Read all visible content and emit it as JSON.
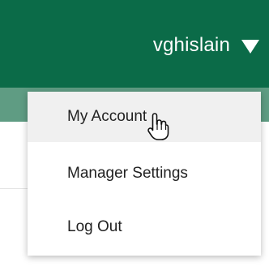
{
  "header": {
    "username": "vghislain",
    "dropdown_icon": "caret-down-icon"
  },
  "menu": {
    "items": [
      {
        "label": "My Account"
      },
      {
        "label": "Manager Settings"
      },
      {
        "label": "Log Out"
      }
    ]
  },
  "colors": {
    "header_bg": "#0b6b48",
    "subheader_bg": "#5f9c83",
    "hover_bg": "#f0f0f0",
    "menu_text": "#222222"
  },
  "cursor": {
    "icon": "hand-pointer-icon"
  }
}
